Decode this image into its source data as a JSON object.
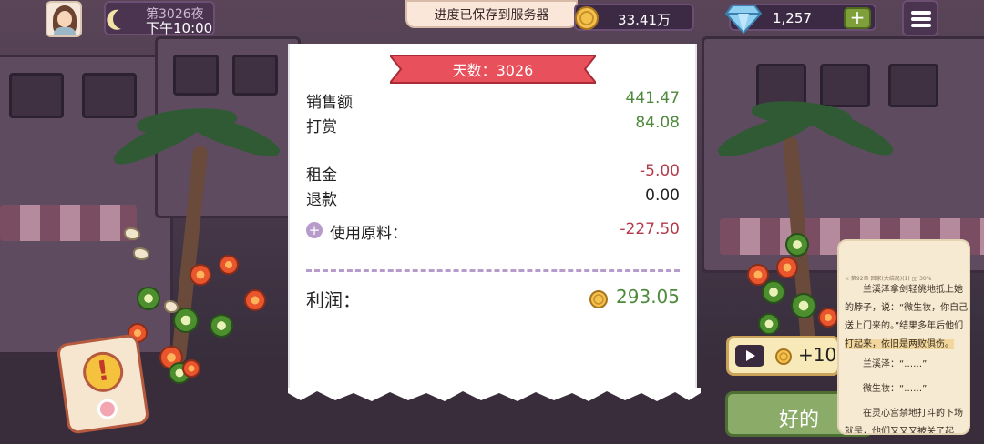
{
  "hud": {
    "day": "第3026夜",
    "time": "下午10:00",
    "toast": "进度已保存到服务器",
    "coins": "33.41万",
    "gems": "1,257",
    "add": "+"
  },
  "receipt": {
    "banner": "天数：3026",
    "rows": [
      {
        "label": "销售额",
        "value": "441.47"
      },
      {
        "label": "打赏",
        "value": "84.08"
      },
      {
        "label": "租金",
        "value": "-5.00"
      },
      {
        "label": "退款",
        "value": "0.00"
      },
      {
        "label": "使用原料：",
        "value": "-227.50"
      }
    ],
    "profit_label": "利润：",
    "profit_value": "293.05",
    "expand": "+"
  },
  "ad": {
    "reward": "+10"
  },
  "ok": "好的",
  "reader": {
    "header": "< 第92章 回家(大结局)(1)  ▯▯ 30%",
    "p1_a": "兰溪泽拿剑轻佻地抵上她的脖子，说：“微生妆，你自己送上门来的。”结果多年后他们",
    "p1_b": "打起来，依旧是两败俱伤。",
    "p2": "兰溪泽：“……”",
    "p3": "微生妆：“……”",
    "p4": "在灵心宫禁地打斗的下场就是，他们又又又被关了起"
  },
  "colors": {
    "sales_green": "#4e8a3b",
    "cost_red": "#b23a4b",
    "banner_red": "#e8505b",
    "ok_green": "#8bab68"
  },
  "icons": [
    "moon-icon",
    "coin-icon",
    "gem-icon",
    "menu-icon",
    "play-icon",
    "alert-icon"
  ]
}
